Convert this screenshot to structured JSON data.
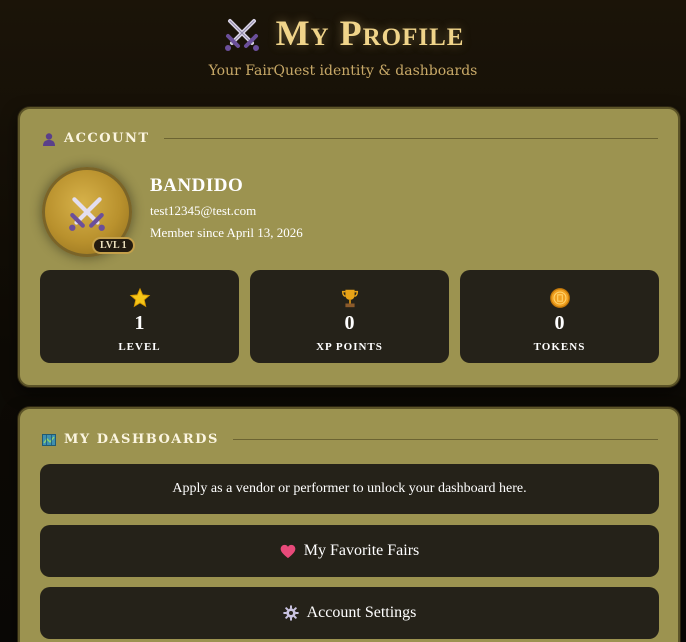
{
  "header": {
    "title": "My Profile",
    "subtitle": "Your FairQuest identity & dashboards",
    "icon": "crossed-swords-icon"
  },
  "account": {
    "section_label": "ACCOUNT",
    "section_icon": "user-icon",
    "avatar_icon": "crossed-swords-icon",
    "level_badge": "LVL 1",
    "username": "BANDIDO",
    "email": "test12345@test.com",
    "member_since": "Member since April 13, 2026",
    "stats": [
      {
        "icon": "star-icon",
        "value": "1",
        "label": "LEVEL"
      },
      {
        "icon": "trophy-icon",
        "value": "0",
        "label": "XP POINTS"
      },
      {
        "icon": "coin-icon",
        "value": "0",
        "label": "TOKENS"
      }
    ]
  },
  "dashboards": {
    "section_label": "MY DASHBOARDS",
    "section_icon": "map-icon",
    "notice": "Apply as a vendor or performer to unlock your dashboard here.",
    "favorite_fairs": {
      "label": "My Favorite Fairs",
      "icon": "heart-icon"
    },
    "account_settings": {
      "label": "Account Settings",
      "icon": "gear-icon"
    }
  },
  "colors": {
    "panel_bg": "#9c9350",
    "card_bg": "#252219",
    "title_gold": "#f0d48a",
    "subtitle_gold": "#c8a968",
    "heart": "#e84a7a"
  }
}
